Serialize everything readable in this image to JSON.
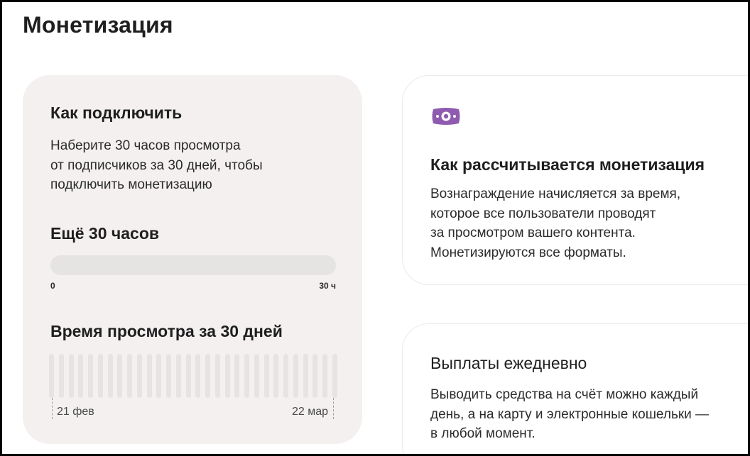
{
  "page": {
    "title": "Монетизация"
  },
  "connect": {
    "title": "Как подключить",
    "line1": "Наберите 30 часов просмотра",
    "line2": "от подписчиков за 30 дней, чтобы",
    "line3": "подключить монетизацию"
  },
  "remaining": {
    "title": "Ещё 30 часов",
    "progress_fraction": 0,
    "min_label": "0",
    "max_label": "30 ч"
  },
  "watch_time": {
    "title": "Время просмотра за 30 дней",
    "daily_hours": [
      0,
      0,
      0,
      0,
      0,
      0,
      0,
      0,
      0,
      0,
      0,
      0,
      0,
      0,
      0,
      0,
      0,
      0,
      0,
      0,
      0,
      0,
      0,
      0,
      0,
      0,
      0,
      0,
      0,
      0
    ],
    "start_date": "21 фев",
    "end_date": "22 мар"
  },
  "calculation": {
    "icon": "money-icon",
    "title": "Как рассчитывается монетизация",
    "line1": "Вознаграждение начисляется за время,",
    "line2": "которое все пользователи проводят",
    "line3": "за просмотром вашего контента.",
    "line4": "Монетизируются все форматы."
  },
  "payouts": {
    "title": "Выплаты ежедневно",
    "line1": "Выводить средства на счёт можно каждый",
    "line2": "день, а на карту и электронные кошельки —",
    "line3": "в любой момент."
  },
  "colors": {
    "accent": "#8f5bb0",
    "card_bg": "#f3f0ef",
    "bar_bg": "#e6e4e2"
  }
}
